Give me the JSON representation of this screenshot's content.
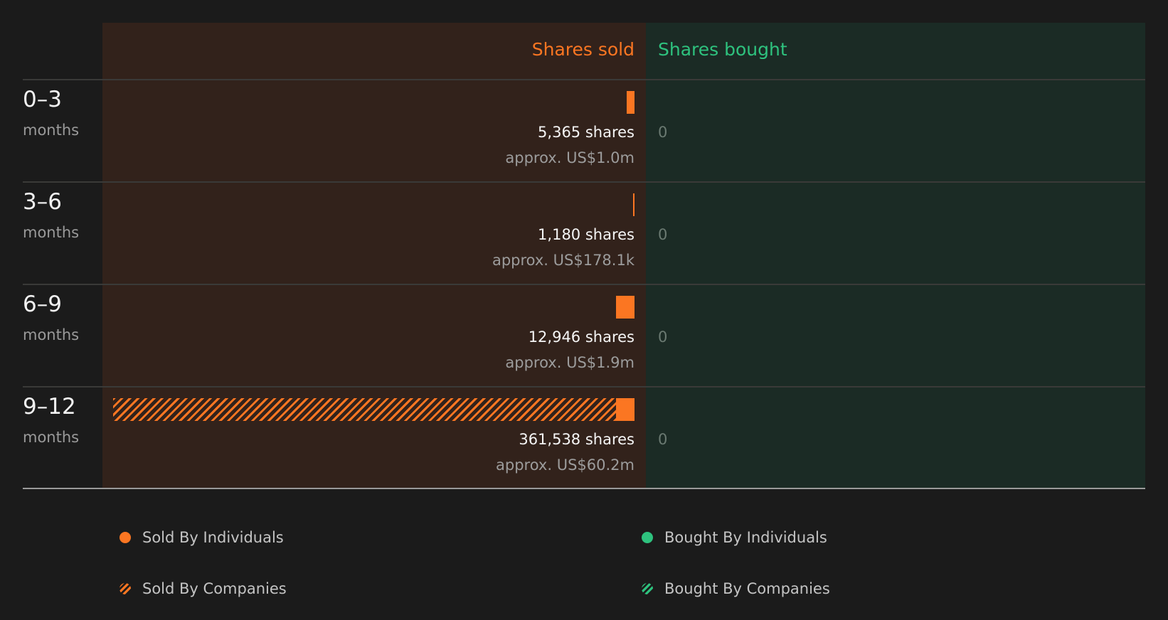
{
  "chart_data": {
    "type": "bar",
    "headers": {
      "sold": "Shares sold",
      "bought": "Shares bought"
    },
    "rows": [
      {
        "period": "0–3",
        "unit": "months",
        "sold_individuals": 5365,
        "sold_companies": 0,
        "shares_text": "5,365 shares",
        "approx_text": "approx. US$1.0m",
        "bought_text": "0"
      },
      {
        "period": "3–6",
        "unit": "months",
        "sold_individuals": 1180,
        "sold_companies": 0,
        "shares_text": "1,180 shares",
        "approx_text": "approx. US$178.1k",
        "bought_text": "0"
      },
      {
        "period": "6–9",
        "unit": "months",
        "sold_individuals": 12946,
        "sold_companies": 0,
        "shares_text": "12,946 shares",
        "approx_text": "approx. US$1.9m",
        "bought_text": "0"
      },
      {
        "period": "9–12",
        "unit": "months",
        "sold_individuals": 13000,
        "sold_companies": 348538,
        "shares_text": "361,538 shares",
        "approx_text": "approx. US$60.2m",
        "bought_text": "0"
      }
    ],
    "legend": [
      {
        "label": "Sold By Individuals",
        "color": "#fb7622",
        "style": "solid"
      },
      {
        "label": "Bought By Individuals",
        "color": "#2ec27e",
        "style": "solid"
      },
      {
        "label": "Sold By Companies",
        "color": "#fb7622",
        "style": "hatched"
      },
      {
        "label": "Bought By Companies",
        "color": "#2ec27e",
        "style": "hatched"
      }
    ],
    "xmax": 361538,
    "colors": {
      "sold": "#fb7622",
      "bought": "#2ec27e"
    }
  }
}
